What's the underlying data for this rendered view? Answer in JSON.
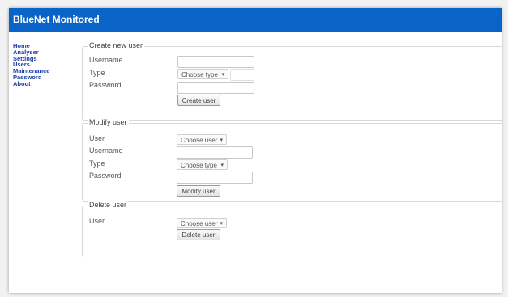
{
  "header": {
    "title": "BlueNet Monitored"
  },
  "nav": [
    {
      "label": "Home"
    },
    {
      "label": "Analyser"
    },
    {
      "label": "Settings"
    },
    {
      "label": "Users"
    },
    {
      "label": "Maintenance"
    },
    {
      "label": "Password"
    },
    {
      "label": "About"
    }
  ],
  "create": {
    "title": "Create new user",
    "username_label": "Username",
    "type_label": "Type",
    "password_label": "Password",
    "type_select": "Choose type",
    "button": "Create user"
  },
  "modify": {
    "title": "Modify user",
    "user_label": "User",
    "username_label": "Username",
    "type_label": "Type",
    "password_label": "Password",
    "user_select": "Choose user",
    "type_select": "Choose type",
    "button": "Modify user"
  },
  "delete": {
    "title": "Delete user",
    "user_label": "User",
    "user_select": "Choose user",
    "button": "Delete user"
  },
  "colors": {
    "header": "#0a64c8",
    "nav_link": "#1a3ca8"
  }
}
